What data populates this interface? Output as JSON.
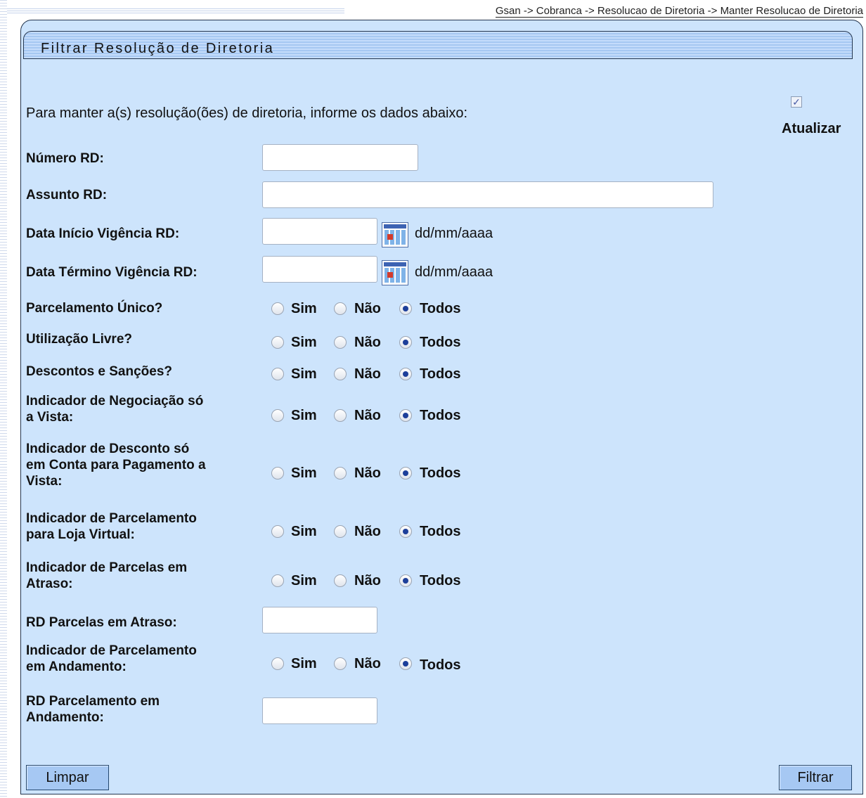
{
  "breadcrumb": "Gsan -> Cobranca -> Resolucao de Diretoria -> Manter Resolucao de Diretoria",
  "header": {
    "title": "Filtrar Resolução de Diretoria"
  },
  "intro": "Para manter a(s) resolução(ões) de diretoria, informe os dados abaixo:",
  "update": {
    "label": "Atualizar",
    "checked": true
  },
  "fields": {
    "numero_rd": {
      "label": "Número RD:",
      "value": ""
    },
    "assunto_rd": {
      "label": "Assunto RD:",
      "value": ""
    },
    "data_inicio": {
      "label": "Data Início Vigência RD:",
      "value": "",
      "format": "dd/mm/aaaa"
    },
    "data_termino": {
      "label": "Data Término Vigência RD:",
      "value": "",
      "format": "dd/mm/aaaa"
    },
    "rd_parcelas_atraso": {
      "label": "RD Parcelas em Atraso:",
      "value": ""
    },
    "rd_parcelamento_andamento": {
      "label_line1": "RD Parcelamento em",
      "label_line2": "Andamento:",
      "value": ""
    }
  },
  "options": {
    "sim": "Sim",
    "nao": "Não",
    "todos": "Todos"
  },
  "radio_groups": [
    {
      "lines": [
        "Parcelamento Único?"
      ],
      "selected": "Todos"
    },
    {
      "lines": [
        "Utilização Livre?"
      ],
      "selected": "Todos"
    },
    {
      "lines": [
        "Descontos e Sanções?"
      ],
      "selected": "Todos"
    },
    {
      "lines": [
        "Indicador de Negociação só",
        "a Vista:"
      ],
      "selected": "Todos"
    },
    {
      "lines": [
        "Indicador de Desconto só",
        "em Conta para Pagamento a",
        "Vista:"
      ],
      "selected": "Todos"
    },
    {
      "lines": [
        "Indicador de Parcelamento",
        "para Loja Virtual:"
      ],
      "selected": "Todos"
    },
    {
      "lines": [
        "Indicador de Parcelas em",
        "Atraso:"
      ],
      "selected": "Todos"
    },
    {
      "lines": [
        "Indicador de Parcelamento",
        "em Andamento:"
      ],
      "selected": "Todos"
    }
  ],
  "buttons": {
    "clear": "Limpar",
    "filter": "Filtrar"
  }
}
